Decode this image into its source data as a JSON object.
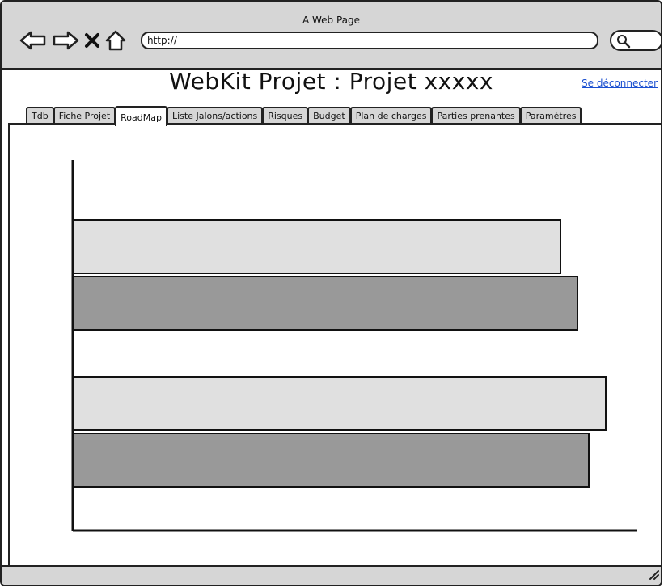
{
  "browser": {
    "window_title": "A Web Page",
    "url": "http://",
    "icons": [
      "back-arrow-icon",
      "forward-arrow-icon",
      "close-icon",
      "home-icon",
      "search-icon"
    ]
  },
  "header": {
    "title": "WebKit Projet : Projet xxxxx",
    "logout_label": "Se déconnecter"
  },
  "tabs": [
    {
      "label": "Tdb",
      "active": false
    },
    {
      "label": "Fiche Projet",
      "active": false
    },
    {
      "label": "RoadMap",
      "active": true
    },
    {
      "label": "Liste Jalons/actions",
      "active": false
    },
    {
      "label": "Risques",
      "active": false
    },
    {
      "label": "Budget",
      "active": false
    },
    {
      "label": "Plan de charges",
      "active": false
    },
    {
      "label": "Parties prenantes",
      "active": false
    },
    {
      "label": "Paramètres",
      "active": false
    }
  ],
  "chart_data": {
    "type": "bar",
    "orientation": "horizontal",
    "grid": false,
    "legend": "none",
    "xlim": [
      0,
      100
    ],
    "categories": [
      "",
      ""
    ],
    "series": [
      {
        "color": "#e0e0e0",
        "values": [
          86,
          94
        ]
      },
      {
        "color": "#999999",
        "values": [
          89,
          91
        ]
      }
    ]
  }
}
